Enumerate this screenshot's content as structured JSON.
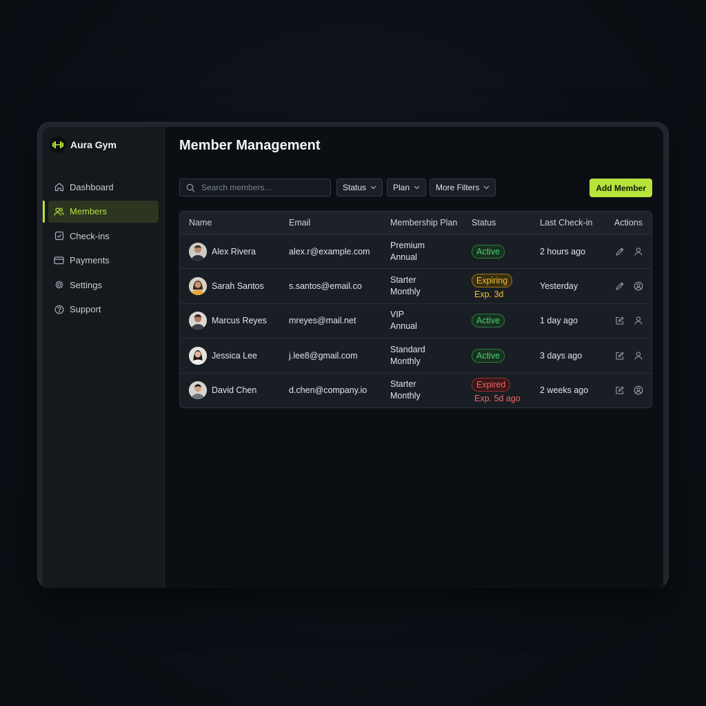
{
  "app": {
    "name": "Aura Gym",
    "accent": "#b7e33b"
  },
  "sidebar": {
    "items": [
      {
        "label": "Dashboard",
        "icon": "home-icon",
        "active": false
      },
      {
        "label": "Members",
        "icon": "users-icon",
        "active": true
      },
      {
        "label": "Check-ins",
        "icon": "check-square-icon",
        "active": false
      },
      {
        "label": "Payments",
        "icon": "credit-card-icon",
        "active": false
      },
      {
        "label": "Settings",
        "icon": "gear-icon",
        "active": false
      },
      {
        "label": "Support",
        "icon": "help-circle-icon",
        "active": false
      }
    ]
  },
  "main": {
    "title": "Member Management",
    "search": {
      "placeholder": "Search members...",
      "value": ""
    },
    "filters": {
      "status": "Status",
      "plan": "Plan",
      "more": "More Filters"
    },
    "add_button": "Add Member"
  },
  "table": {
    "columns": [
      "Name",
      "Email",
      "Membership Plan",
      "Status",
      "Last Check-in",
      "Actions"
    ],
    "rows": [
      {
        "name": "Alex Rivera",
        "email": "alex.r@example.com",
        "plan_1": "Premium",
        "plan_2": "Annual",
        "status": "Active",
        "status_type": "active",
        "status_note": "",
        "last_checkin": "2 hours ago"
      },
      {
        "name": "Sarah Santos",
        "email": "s.santos@email.co",
        "plan_1": "Starter",
        "plan_2": "Monthly",
        "status": "Expiring",
        "status_type": "expiring",
        "status_note": "Exp. 3d",
        "last_checkin": "Yesterday"
      },
      {
        "name": "Marcus Reyes",
        "email": "mreyes@mail.net",
        "plan_1": "VIP",
        "plan_2": "Annual",
        "status": "Active",
        "status_type": "active",
        "status_note": "",
        "last_checkin": "1 day ago"
      },
      {
        "name": "Jessica Lee",
        "email": "j.lee8@gmail.com",
        "plan_1": "Standard",
        "plan_2": "Monthly",
        "status": "Active",
        "status_type": "active",
        "status_note": "",
        "last_checkin": "3 days ago"
      },
      {
        "name": "David Chen",
        "email": "d.chen@company.io",
        "plan_1": "Starter",
        "plan_2": "Monthly",
        "status": "Expired",
        "status_type": "expired",
        "status_note": "Exp. 5d ago",
        "last_checkin": "2 weeks ago"
      }
    ]
  }
}
